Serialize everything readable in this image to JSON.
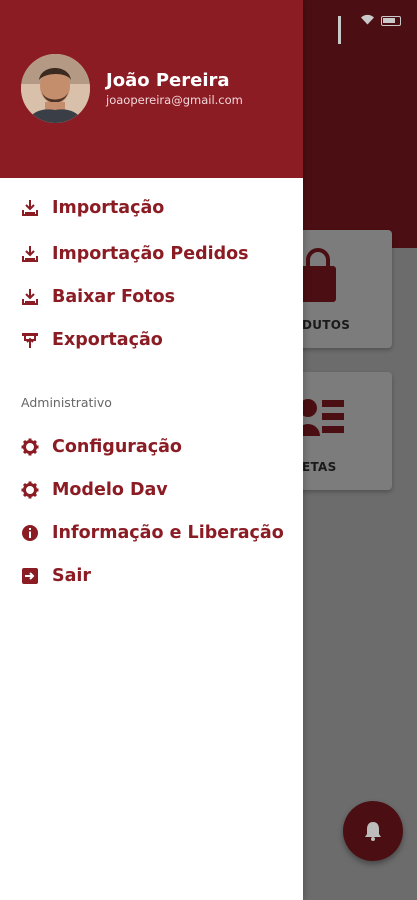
{
  "user": {
    "name": "João Pereira",
    "email": "joaopereira@gmail.com"
  },
  "menu": {
    "items": [
      {
        "label": "Importação",
        "icon": "download-tray-icon"
      },
      {
        "label": "Importação Pedidos",
        "icon": "download-tray-icon"
      },
      {
        "label": "Baixar Fotos",
        "icon": "download-tray-icon"
      },
      {
        "label": "Exportação",
        "icon": "upload-icon"
      }
    ],
    "section_title": "Administrativo",
    "admin_items": [
      {
        "label": "Configuração",
        "icon": "gear-icon"
      },
      {
        "label": "Modelo Dav",
        "icon": "gear-icon"
      },
      {
        "label": "Informação e Liberação",
        "icon": "info-icon"
      },
      {
        "label": "Sair",
        "icon": "exit-icon"
      }
    ]
  },
  "background": {
    "card1_label": "DUTOS",
    "card2_label": "ETAS"
  },
  "colors": {
    "primary": "#8b1c24",
    "primary_dark": "#4b0f13",
    "scrim": "#6c6c6c"
  }
}
